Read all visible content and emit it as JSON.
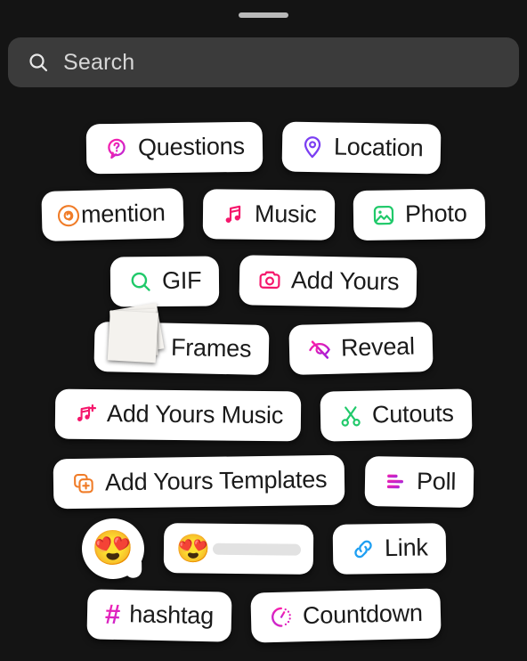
{
  "window": {
    "title": "Story Stickers Tray",
    "background_color": "#141414",
    "grabber_color": "#b9b9b9"
  },
  "search": {
    "placeholder": "Search",
    "icon": "search-icon",
    "background_color": "#3b3b3b",
    "text_color": "#d6d6d6"
  },
  "colors": {
    "pill_background": "#ffffff",
    "pill_text": "#1a1a1a",
    "magenta": "#ff1fa8",
    "purple": "#7b3ff2",
    "orange": "#f07c28",
    "green": "#20c96a",
    "pink": "#f5176c",
    "blue": "#1e9ff2",
    "slider_track": "#e2e2e2"
  },
  "rows": [
    {
      "items": [
        {
          "label": "Questions",
          "icon": "question-bubble-icon",
          "icon_color": "#ff1fa8"
        },
        {
          "label": "Location",
          "icon": "map-pin-icon",
          "icon_color": "#7b3ff2"
        }
      ]
    },
    {
      "items": [
        {
          "label": "mention",
          "icon": "threads-at-icon",
          "icon_color": "#f07c28"
        },
        {
          "label": "Music",
          "icon": "music-note-icon",
          "icon_color": "#f5176c"
        },
        {
          "label": "Photo",
          "icon": "photo-icon",
          "icon_color": "#20c96a"
        }
      ]
    },
    {
      "items": [
        {
          "label": "GIF",
          "icon": "gif-search-icon",
          "icon_color": "#20c96a"
        },
        {
          "label": "Add Yours",
          "icon": "camera-icon",
          "icon_color": "#f5176c"
        }
      ]
    },
    {
      "items": [
        {
          "label": "Frames",
          "icon": "polaroid-photo-icon",
          "icon_color": "#f4f2ee"
        },
        {
          "label": "Reveal",
          "icon": "eye-slash-icon",
          "icon_color": "#d41ad4"
        }
      ]
    },
    {
      "items": [
        {
          "label": "Add Yours Music",
          "icon": "music-note-plus-icon",
          "icon_color": "#f5176c"
        },
        {
          "label": "Cutouts",
          "icon": "scissors-icon",
          "icon_color": "#20c96a"
        }
      ]
    },
    {
      "items": [
        {
          "label": "Add Yours Templates",
          "icon": "templates-plus-icon",
          "icon_color": "#f07c28"
        },
        {
          "label": "Poll",
          "icon": "poll-bars-icon",
          "icon_color": "#d41ad4"
        }
      ]
    },
    {
      "items": [
        {
          "label": "",
          "icon": "emoji-reaction-icon",
          "emoji": "😍"
        },
        {
          "label": "",
          "icon": "emoji-slider-icon",
          "emoji": "😍"
        },
        {
          "label": "Link",
          "icon": "link-chain-icon",
          "icon_color": "#1e9ff2"
        }
      ]
    },
    {
      "items": [
        {
          "label": "hashtag",
          "icon": "hashtag-icon",
          "icon_color": "#ff1fa8",
          "glyph": "#"
        },
        {
          "label": "Countdown",
          "icon": "countdown-timer-icon",
          "icon_color": "#d41ad4"
        }
      ]
    }
  ]
}
